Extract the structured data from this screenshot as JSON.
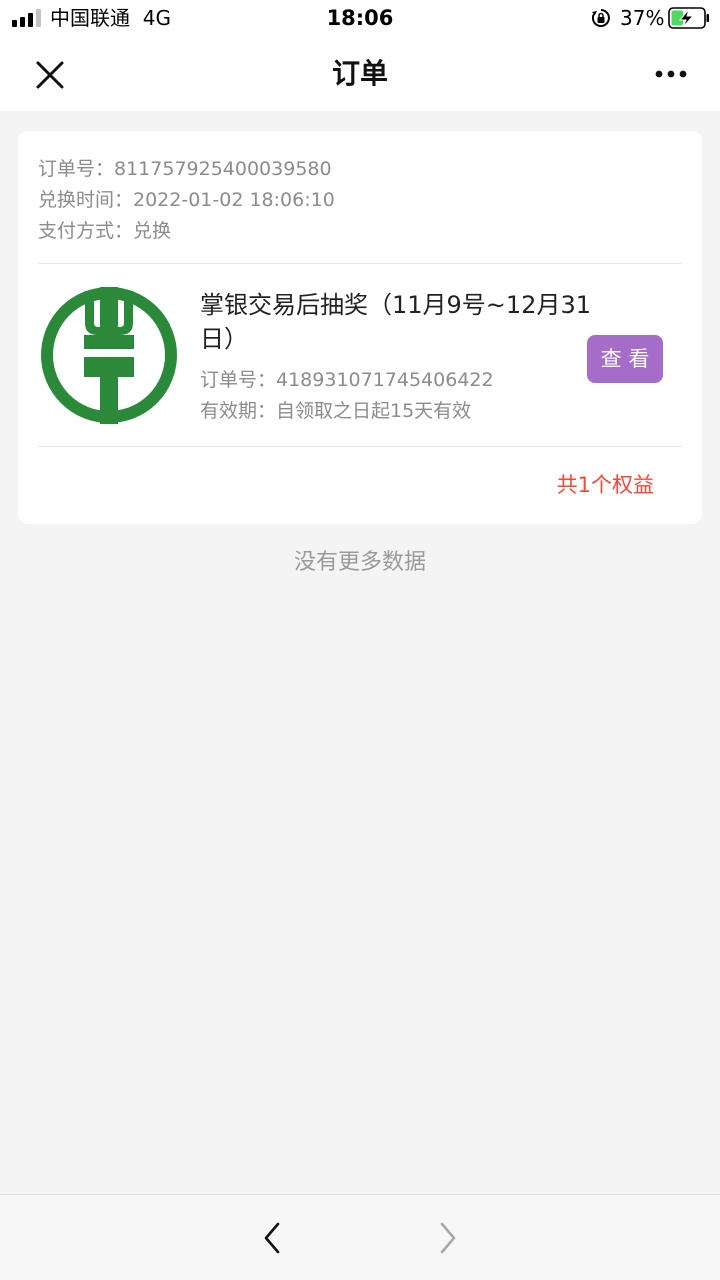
{
  "status_bar": {
    "carrier": "中国联通  4G",
    "time": "18:06",
    "battery_percent": "37%",
    "battery_level": 0.37,
    "charging": true
  },
  "nav": {
    "title": "订单",
    "close_icon": "close-icon",
    "more_icon": "more-dots-icon"
  },
  "order": {
    "order_no": "订单号：811757925400039580",
    "exchange_time": "兑换时间：2022-01-02 18:06:10",
    "payment_method": "支付方式：兑换",
    "item": {
      "logo": "agricultural-bank-logo",
      "title": "掌银交易后抽奖（11月9号~12月31日）",
      "order_no": "订单号：418931071745406422",
      "validity": "有效期：自领取之日起15天有效",
      "view_button": "查 看"
    },
    "total": "共1个权益"
  },
  "footer_text": "没有更多数据",
  "bottom_bar": {
    "back_icon": "chevron-left-icon",
    "forward_icon": "chevron-right-icon"
  },
  "colors": {
    "brand_green": "#2a8a3a",
    "button_purple": "#a56dc8",
    "total_red": "#f0493a"
  }
}
